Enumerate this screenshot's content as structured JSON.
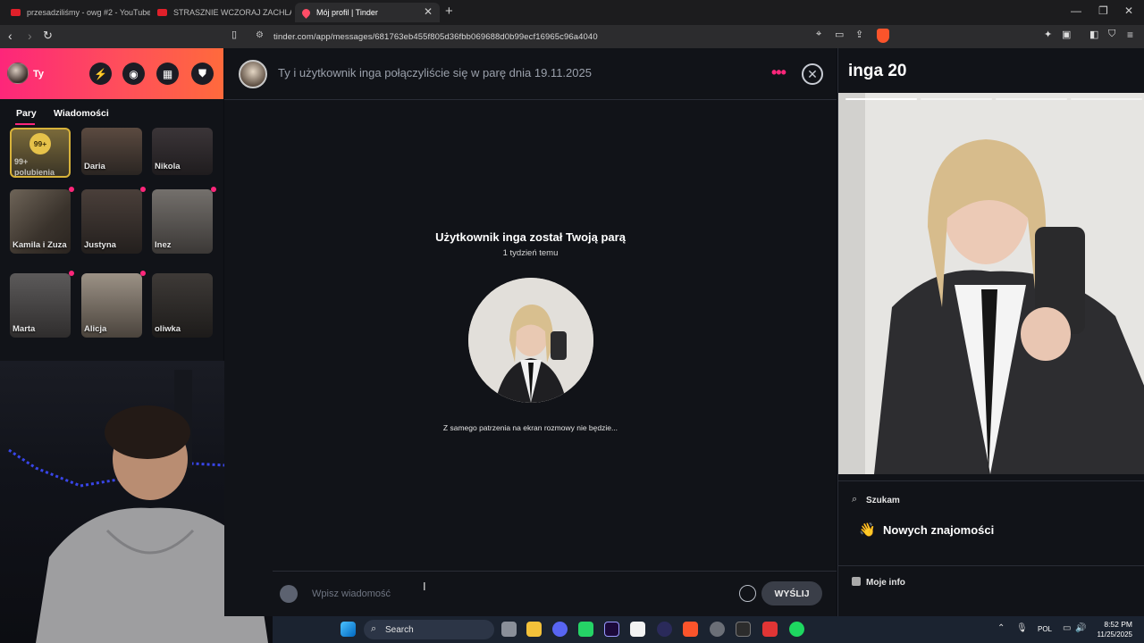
{
  "browser": {
    "tabs": [
      {
        "title": "przesadziliśmy - owg #2 - YouTube",
        "active": false,
        "icon": "youtube-icon"
      },
      {
        "title": "STRASZNIE WCZORAJ ZACHLALIŚMY",
        "active": false,
        "icon": "youtube-icon"
      },
      {
        "title": "Mój profil | Tinder",
        "active": true,
        "icon": "tinder-icon"
      }
    ],
    "url": "tinder.com/app/messages/681763eb455f805d36fbb069688d0b99ecf16965c96a4040"
  },
  "sidebar": {
    "user_label": "Ty",
    "tabs": [
      "Pary",
      "Wiadomości"
    ],
    "likes_badge": "99+",
    "likes_label": "99+ polubienia",
    "matches": [
      {
        "name": "Daria",
        "unread": false
      },
      {
        "name": "Nikola",
        "unread": false
      },
      {
        "name": "Kamila i Zuza",
        "unread": true
      },
      {
        "name": "Justyna",
        "unread": true
      },
      {
        "name": "Inez",
        "unread": true
      },
      {
        "name": "Marta",
        "unread": true
      },
      {
        "name": "Alicja",
        "unread": false
      },
      {
        "name": "oliwka",
        "unread": true
      }
    ]
  },
  "chat": {
    "header_text": "Ty i użytkownik inga połączyliście się w parę dnia 19.11.2025",
    "match_title": "Użytkownik inga został Twoją parą",
    "match_time": "1 tydzień temu",
    "hint": "Z samego patrzenia na ekran rozmowy nie będzie...",
    "input_placeholder": "Wpisz wiadomość",
    "send_label": "WYŚLIJ"
  },
  "profile": {
    "name": "inga 20",
    "looking_for_label": "Szukam",
    "looking_for_value": "Nowych znajomości",
    "info_label": "Moje info"
  },
  "taskbar": {
    "search_label": "Search",
    "language": "POL",
    "time": "8:52 PM",
    "date": "11/25/2025"
  },
  "colors": {
    "tinder_gradient_start": "#fd267a",
    "tinder_gradient_end": "#ff6a3c",
    "background": "#111318"
  }
}
